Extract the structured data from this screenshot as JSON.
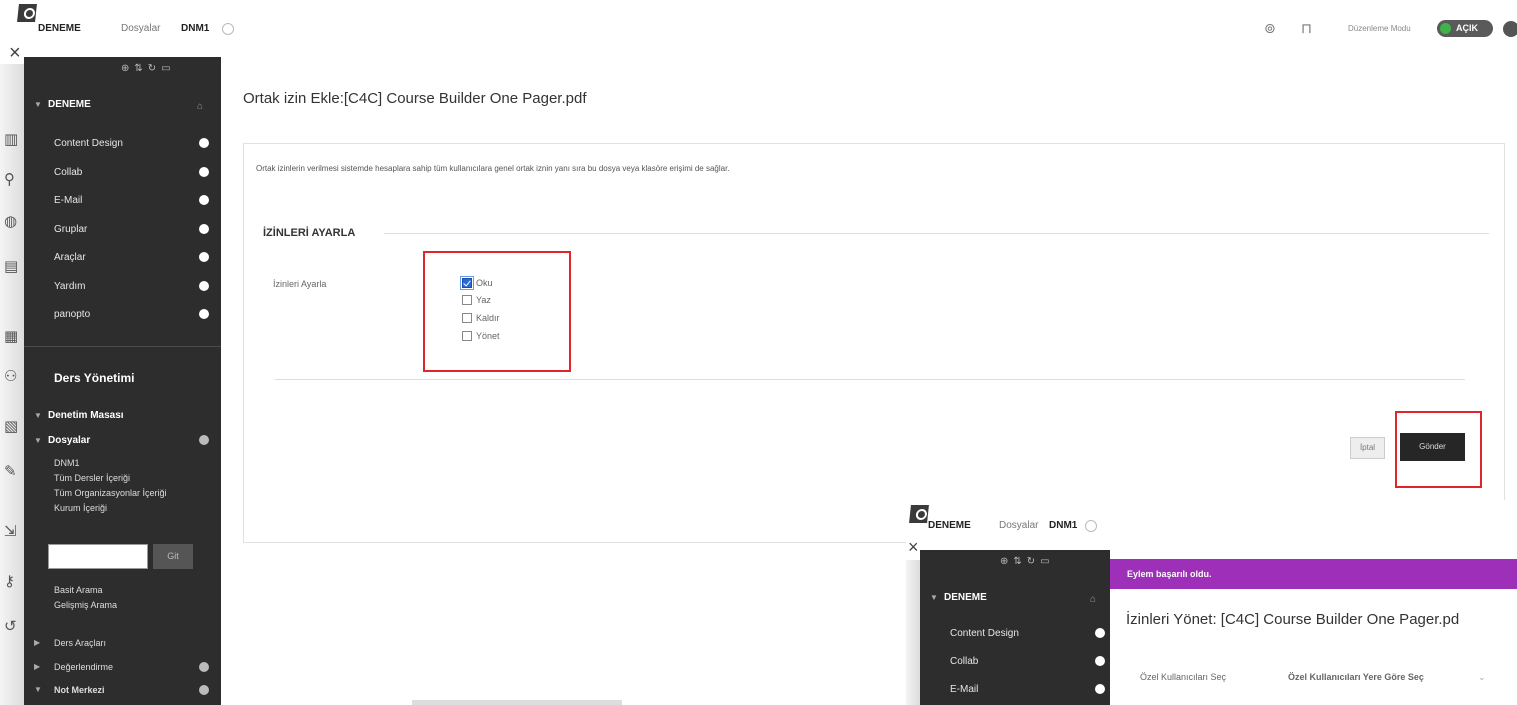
{
  "topbar": {
    "course": "DENEME",
    "files": "Dosyalar",
    "current": "DNM1",
    "edit_mode_label": "Düzenleme Modu",
    "edit_mode_state": "AÇIK"
  },
  "sidebar": {
    "course_title": "DENEME",
    "items": [
      {
        "label": "Content Design"
      },
      {
        "label": "Collab"
      },
      {
        "label": "E-Mail"
      },
      {
        "label": "Gruplar"
      },
      {
        "label": "Araçlar"
      },
      {
        "label": "Yardım"
      },
      {
        "label": "panopto"
      }
    ],
    "management_title": "Ders Yönetimi",
    "control_panel": "Denetim Masası",
    "files_section": "Dosyalar",
    "files_sub": [
      "DNM1",
      "Tüm Dersler İçeriği",
      "Tüm Organizasyonlar İçeriği",
      "Kurum İçeriği"
    ],
    "search_go": "Git",
    "basic_search": "Basit Arama",
    "advanced_search": "Gelişmiş Arama",
    "course_tools": "Ders Araçları",
    "evaluation": "Değerlendirme",
    "grade_center": "Not Merkezi"
  },
  "main": {
    "title": "Ortak izin Ekle:[C4C] Course Builder One Pager.pdf",
    "description": "Ortak izinlerin verilmesi sistemde hesaplara sahip tüm kullanıcılara genel ortak iznin yanı sıra bu dosya veya klasöre erişimi de sağlar.",
    "section_title": "İZİNLERİ AYARLA",
    "field_label": "İzinleri Ayarla",
    "permissions": [
      {
        "label": "Oku",
        "checked": true
      },
      {
        "label": "Yaz",
        "checked": false
      },
      {
        "label": "Kaldır",
        "checked": false
      },
      {
        "label": "Yönet",
        "checked": false
      }
    ],
    "cancel_label": "İptal",
    "submit_label": "Gönder"
  },
  "inset": {
    "course": "DENEME",
    "files": "Dosyalar",
    "current": "DNM1",
    "success_message": "Eylem başarılı oldu.",
    "title": "İzinleri Yönet: [C4C] Course Builder One Pager.pd",
    "sidebar_course": "DENEME",
    "sidebar_items": [
      "Content Design",
      "Collab",
      "E-Mail"
    ],
    "tab_users": "Özel Kullanıcıları Seç",
    "tab_role": "Özel Kullanıcıları Yere Göre Seç"
  },
  "colors": {
    "sidebar_bg": "#2d2d2d",
    "success_bar": "#9e2fb8",
    "highlight_box": "#e0262c",
    "toggle_on": "#3fb24b",
    "checkbox_checked": "#2a6ad6"
  }
}
